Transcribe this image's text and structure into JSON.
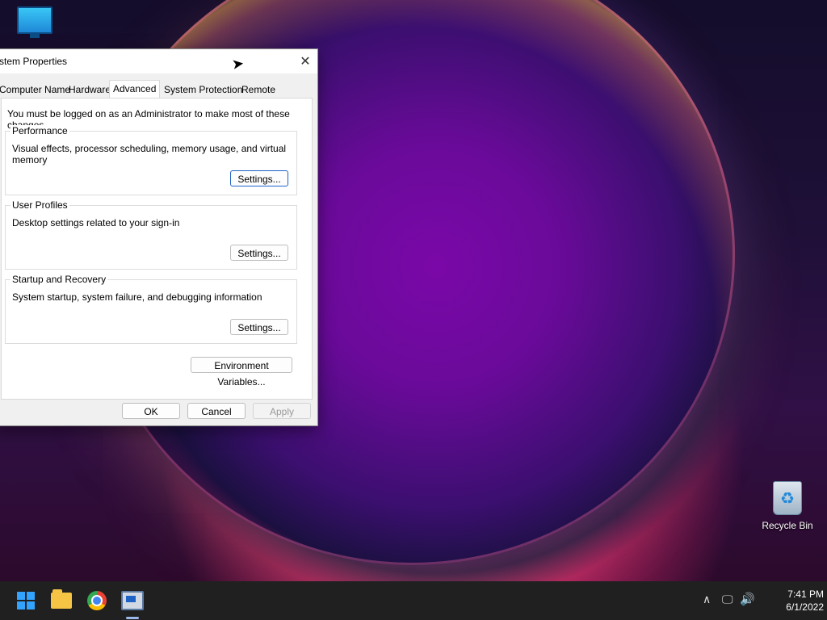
{
  "desktop": {
    "icons": [
      {
        "name": "This PC",
        "label": ""
      },
      {
        "name": "Recycle Bin",
        "label": "Recycle Bin"
      }
    ]
  },
  "window": {
    "title": "ystem Properties",
    "tabs": [
      "Computer Name",
      "Hardware",
      "Advanced",
      "System Protection",
      "Remote"
    ],
    "active_tab": "Advanced",
    "note": "You must be logged on as an Administrator to make most of these changes.",
    "groups": [
      {
        "title": "Performance",
        "desc": "Visual effects, processor scheduling, memory usage, and virtual memory",
        "button": "Settings..."
      },
      {
        "title": "User Profiles",
        "desc": "Desktop settings related to your sign-in",
        "button": "Settings..."
      },
      {
        "title": "Startup and Recovery",
        "desc": "System startup, system failure, and debugging information",
        "button": "Settings..."
      }
    ],
    "env_button": "Environment Variables...",
    "footer": {
      "ok": "OK",
      "cancel": "Cancel",
      "apply": "Apply"
    },
    "close_glyph": "✕"
  },
  "taskbar": {
    "clock": {
      "time": "7:41 PM",
      "date": "6/1/2022"
    },
    "tray": {
      "up": "∧",
      "network": "🖵",
      "volume": "🔊"
    }
  },
  "colors": {
    "accent": "#1f62c6",
    "taskbar": "#202020",
    "window_bg": "#f0f0f0"
  }
}
